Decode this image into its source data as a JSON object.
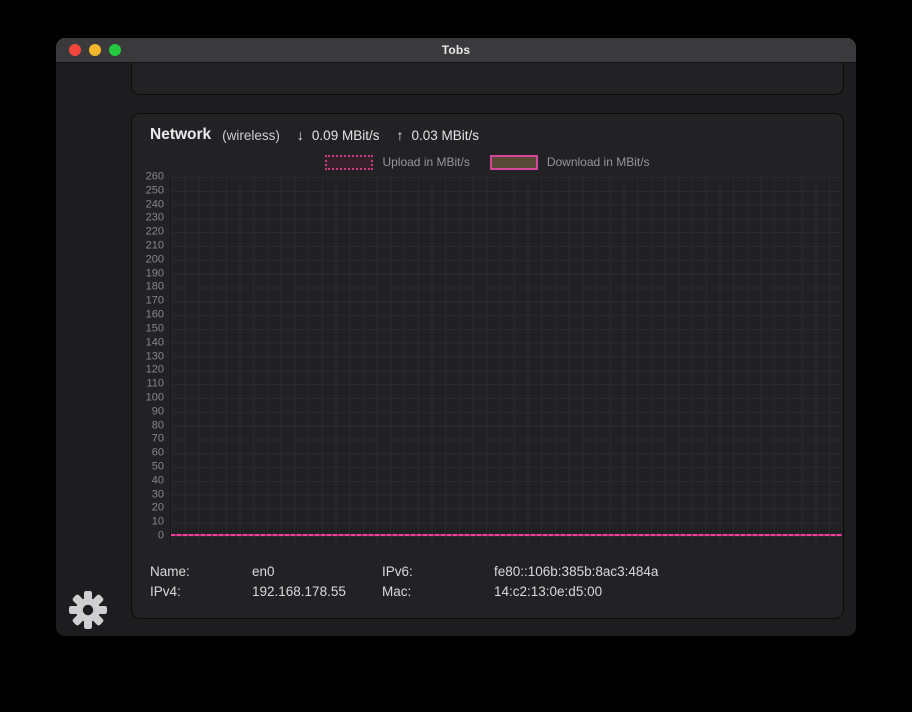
{
  "titlebar": {
    "title": "Tobs"
  },
  "traffic_lights": {
    "close": "#f1453d",
    "minimize": "#f5b62e",
    "zoom": "#23c93f"
  },
  "network": {
    "title": "Network",
    "subtitle": "(wireless)",
    "down_arrow": "↓",
    "down_value": "0.09 MBit/s",
    "up_arrow": "↑",
    "up_value": "0.03 MBit/s",
    "legend": [
      {
        "label": "Upload in MBit/s",
        "style": "dotted",
        "border_color": "#c73c80"
      },
      {
        "label": "Download in MBit/s",
        "style": "solid",
        "border_color": "#d6479b",
        "fill_color": "#564936"
      }
    ],
    "info": [
      {
        "label": "Name:",
        "value": "en0"
      },
      {
        "label": "IPv6:",
        "value": "fe80::106b:385b:8ac3:484a"
      },
      {
        "label": "IPv4:",
        "value": "192.168.178.55"
      },
      {
        "label": "Mac:",
        "value": "14:c2:13:0e:d5:00"
      }
    ]
  },
  "chart_data": {
    "type": "line",
    "title": "",
    "xlabel": "",
    "ylabel": "",
    "ylim": [
      0,
      260
    ],
    "ytick_step": 10,
    "yticks": [
      260,
      250,
      240,
      230,
      220,
      210,
      200,
      190,
      180,
      170,
      160,
      150,
      140,
      130,
      120,
      110,
      100,
      90,
      80,
      70,
      60,
      50,
      40,
      30,
      20,
      10,
      0
    ],
    "grid": true,
    "legend_position": "top",
    "series": [
      {
        "name": "Upload in MBit/s",
        "color": "#ef3f9f",
        "line_style": "dashed",
        "shape": "flat",
        "constant_value": 0
      },
      {
        "name": "Download in MBit/s",
        "color": "#d6479b",
        "line_style": "solid",
        "shape": "flat",
        "constant_value": 0
      }
    ]
  },
  "colors": {
    "window_bg": "#1d1d1f",
    "titlebar_bg": "#3a3a3c",
    "panel_bg": "#222225",
    "plot_bg": "#212124",
    "grid_line": "#2a2a2d",
    "accent_pink": "#ef3f9f"
  }
}
